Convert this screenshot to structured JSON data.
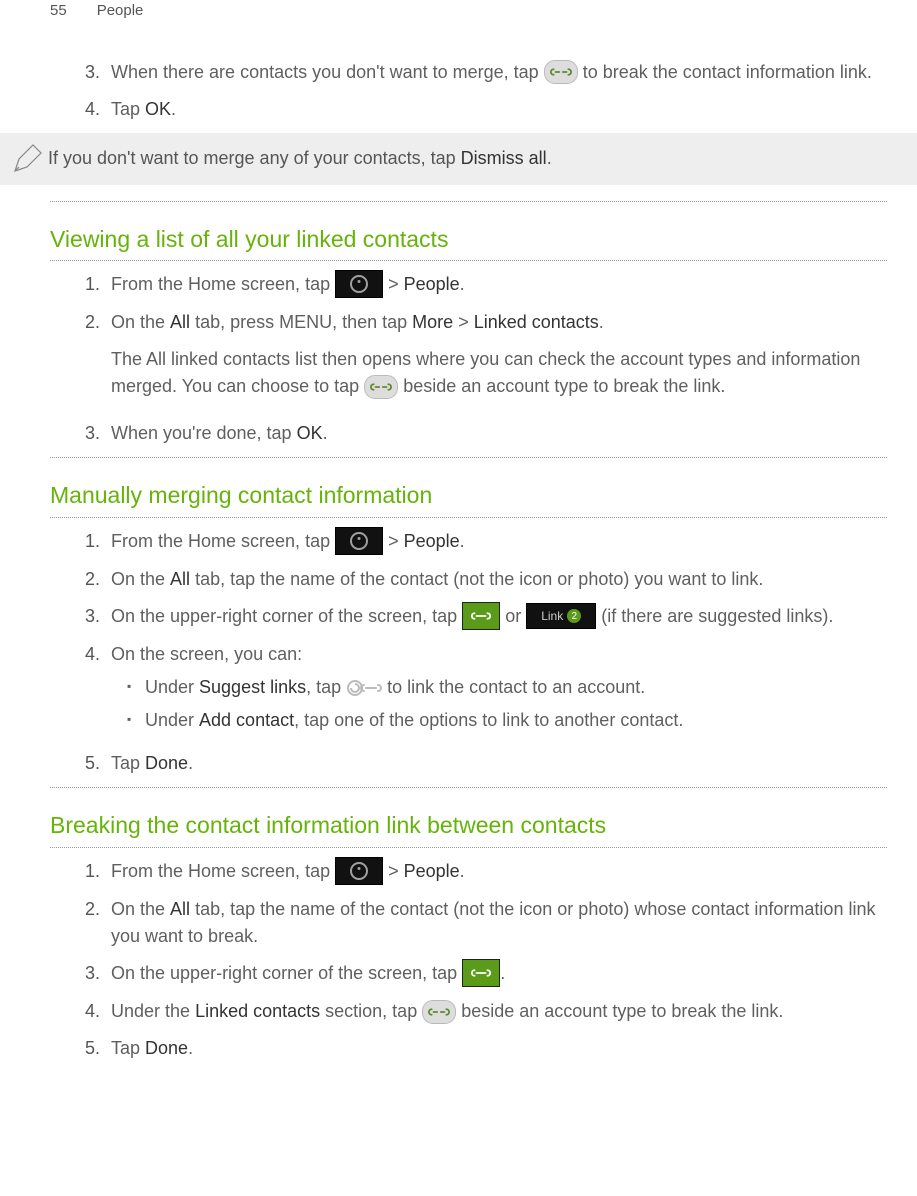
{
  "header": {
    "page_number": "55",
    "section": "People"
  },
  "intro_steps": {
    "s3_a": "When there are contacts you don't want to merge, tap ",
    "s3_b": " to break the contact information link.",
    "s4_a": "Tap ",
    "s4_b": "OK",
    "s4_c": "."
  },
  "note": {
    "a": "If you don't want to merge any of your contacts, tap ",
    "b": "Dismiss all",
    "c": "."
  },
  "section1": {
    "title": "Viewing a list of all your linked contacts",
    "s1_a": "From the Home screen, tap ",
    "s1_b": " > ",
    "s1_c": "People",
    "s1_d": ".",
    "s2_a": "On the ",
    "s2_b": "All",
    "s2_c": " tab, press MENU, then tap ",
    "s2_d": "More",
    "s2_e": " > ",
    "s2_f": "Linked contacts",
    "s2_g": ".",
    "s2p_a": "The All linked contacts list then opens where you can check the account types and information merged. You can choose to tap ",
    "s2p_b": " beside an account type to break the link.",
    "s3_a": "When you're done, tap ",
    "s3_b": "OK",
    "s3_c": "."
  },
  "section2": {
    "title": "Manually merging contact information",
    "s1_a": "From the Home screen, tap ",
    "s1_b": " > ",
    "s1_c": "People",
    "s1_d": ".",
    "s2_a": "On the ",
    "s2_b": "All",
    "s2_c": " tab, tap the name of the contact (not the icon or photo) you want to link.",
    "s3_a": "On the upper-right corner of the screen, tap ",
    "s3_b": " or ",
    "s3_c": " (if there are suggested links).",
    "link_label": "Link",
    "link_count": "2",
    "s4_a": "On the screen, you can:",
    "b1_a": "Under ",
    "b1_b": "Suggest links",
    "b1_c": ", tap ",
    "b1_d": " to link the contact to an account.",
    "b2_a": "Under ",
    "b2_b": "Add contact",
    "b2_c": ", tap one of the options to link to another contact.",
    "s5_a": "Tap ",
    "s5_b": "Done",
    "s5_c": "."
  },
  "section3": {
    "title": "Breaking the contact information link between contacts",
    "s1_a": "From the Home screen, tap ",
    "s1_b": " > ",
    "s1_c": "People",
    "s1_d": ".",
    "s2_a": "On the ",
    "s2_b": "All",
    "s2_c": " tab, tap the name of the contact (not the icon or photo) whose contact information link you want to break.",
    "s3_a": "On the upper-right corner of the screen, tap ",
    "s3_b": ".",
    "s4_a": "Under the ",
    "s4_b": "Linked contacts",
    "s4_c": " section, tap ",
    "s4_d": " beside an account type to break the link.",
    "s5_a": "Tap ",
    "s5_b": "Done",
    "s5_c": "."
  }
}
